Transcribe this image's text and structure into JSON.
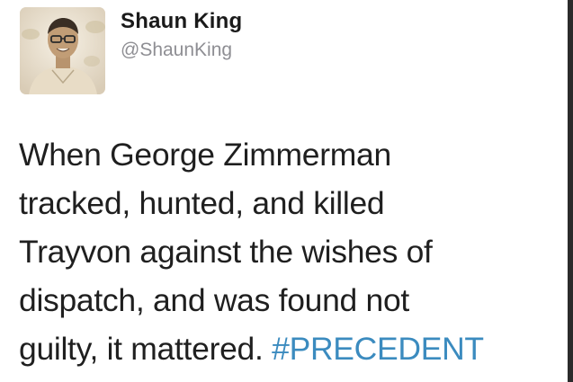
{
  "author": {
    "display_name": "Shaun King",
    "handle": "@ShaunKing",
    "avatar_icon": "profile-photo"
  },
  "tweet": {
    "lines": [
      "When George Zimmerman",
      "tracked, hunted, and killed",
      "Trayvon against the wishes of",
      "dispatch, and was found not",
      "guilty, it mattered."
    ],
    "hashtag": "#PRECEDENT"
  },
  "colors": {
    "hashtag": "#3b8bbf",
    "text": "#1f1f1f",
    "handle": "#8e8e93"
  }
}
